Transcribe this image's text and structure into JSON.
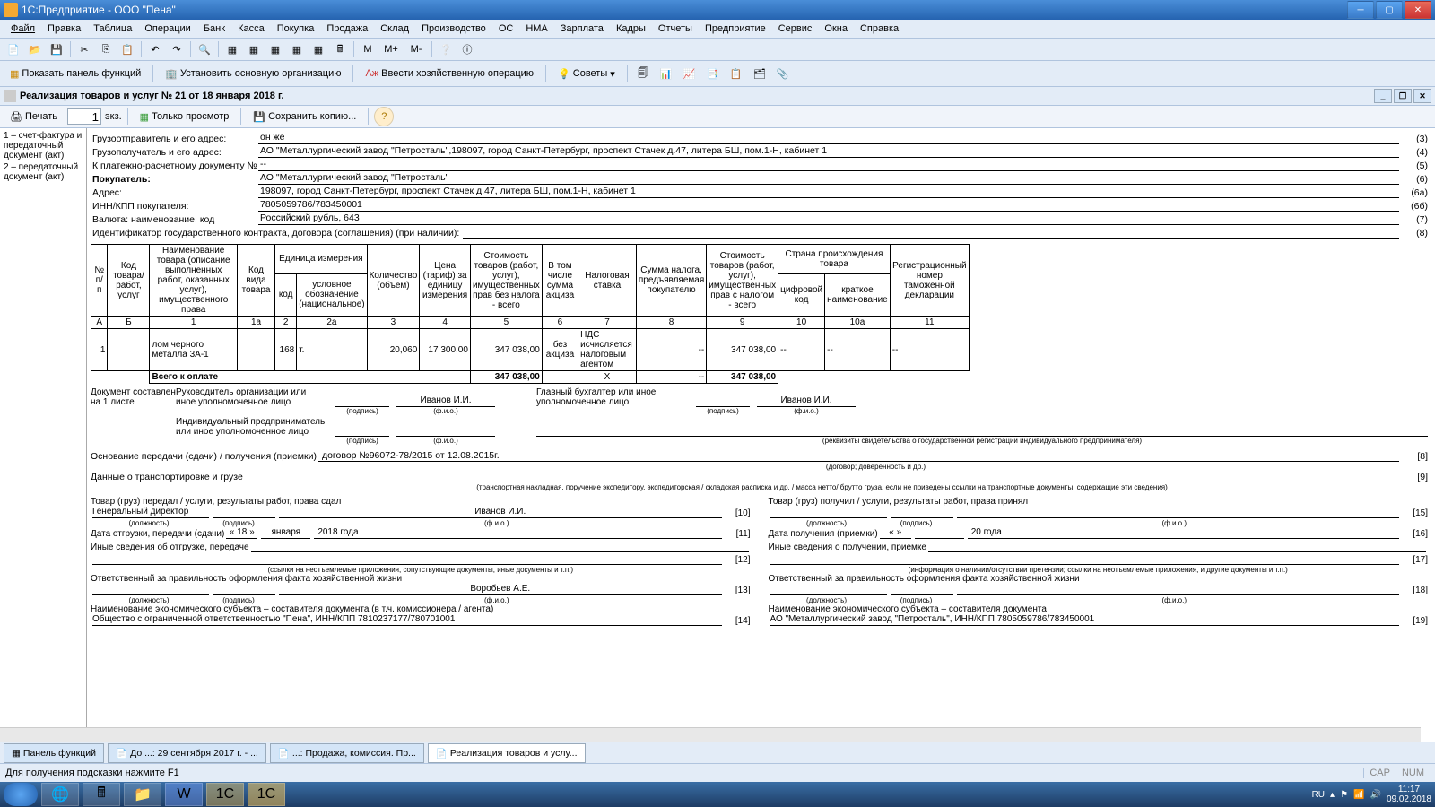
{
  "window": {
    "title": "1С:Предприятие - ООО \"Пена\""
  },
  "menu": [
    "Файл",
    "Правка",
    "Таблица",
    "Операции",
    "Банк",
    "Касса",
    "Покупка",
    "Продажа",
    "Склад",
    "Производство",
    "ОС",
    "НМА",
    "Зарплата",
    "Кадры",
    "Отчеты",
    "Предприятие",
    "Сервис",
    "Окна",
    "Справка"
  ],
  "tb1_text": {
    "m": "M",
    "mplus": "M+",
    "mminus": "M-"
  },
  "tb2": {
    "panel": "Показать панель функций",
    "org": "Установить основную организацию",
    "oper": "Ввести хозяйственную операцию",
    "tips": "Советы"
  },
  "dochdr": "Реализация товаров и услуг № 21 от 18 января 2018 г.",
  "tb3": {
    "print": "Печать",
    "copies": "1",
    "ekz": "экз.",
    "view": "Только просмотр",
    "save": "Сохранить копию..."
  },
  "side": {
    "item1": "1 – счет-фактура и передаточный документ (акт)",
    "item2": "2 – передаточный документ (акт)"
  },
  "hdr": {
    "shipper_lbl": "Грузоотправитель и его адрес:",
    "shipper_val": "он же",
    "shipper_code": "(3)",
    "consignee_lbl": "Грузополучатель и его адрес:",
    "consignee_val": "АО \"Металлургический завод \"Петросталь\",198097, город Санкт-Петербург, проспект Стачек д.47, литера БШ, пом.1-Н, кабинет 1",
    "consignee_code": "(4)",
    "payment_lbl": "К платежно-расчетному документу №",
    "payment_val": "--",
    "payment_code": "(5)",
    "buyer_lbl": "Покупатель:",
    "buyer_val": "АО \"Металлургический завод \"Петросталь\"",
    "buyer_code": "(6)",
    "addr_lbl": "Адрес:",
    "addr_val": "198097, город Санкт-Петербург, проспект Стачек д.47, литера БШ, пом.1-Н, кабинет 1",
    "addr_code": "(6а)",
    "inn_lbl": "ИНН/КПП покупателя:",
    "inn_val": "7805059786/783450001",
    "inn_code": "(6б)",
    "cur_lbl": "Валюта: наименование, код",
    "cur_val": "Российский рубль, 643",
    "cur_code": "(7)",
    "gid_lbl": "Идентификатор государственного контракта, договора (соглашения) (при наличии):",
    "gid_code": "(8)"
  },
  "th": {
    "c1": "№ п/п",
    "c2": "Код товара/ работ, услуг",
    "c3": "Наименование товара (описание выполненных работ, оказанных услуг), имущественного права",
    "c4": "Код вида товара",
    "c5": "Единица измерения",
    "c5a": "код",
    "c5b": "условное обозначение (национальное)",
    "c6": "Количество (объем)",
    "c7": "Цена (тариф) за единицу измерения",
    "c8": "Стоимость товаров (работ, услуг), имущественных прав без налога - всего",
    "c9": "В том числе сумма акциза",
    "c10": "Налоговая ставка",
    "c11": "Сумма налога, предъявляемая покупателю",
    "c12": "Стоимость товаров (работ, услуг), имущественных прав с налогом - всего",
    "c13": "Страна происхождения товара",
    "c13a": "цифровой код",
    "c13b": "краткое наименование",
    "c14": "Регистрационный номер таможенной декларации"
  },
  "idx": {
    "a": "А",
    "b": "Б",
    "1": "1",
    "1a": "1а",
    "2": "2",
    "2a": "2а",
    "3": "3",
    "4": "4",
    "5": "5",
    "6": "6",
    "7": "7",
    "8": "8",
    "9": "9",
    "10": "10",
    "10a": "10а",
    "11": "11"
  },
  "row": {
    "n": "1",
    "name": "лом черного металла 3А-1",
    "unitcode": "168",
    "unitname": "т.",
    "qty": "20,060",
    "price": "17 300,00",
    "sum_wo": "347 038,00",
    "excise": "без акциза",
    "vat": "НДС исчисляется налоговым агентом",
    "tax": "--",
    "sum_w": "347 038,00",
    "ccode": "--",
    "cname": "--",
    "decl": "--"
  },
  "total": {
    "lbl": "Всего к оплате",
    "sum_wo": "347 038,00",
    "x": "Х",
    "tax": "--",
    "sum_w": "347 038,00"
  },
  "sig": {
    "doc_made": "Документ составлен на 1 листе",
    "head": "Руководитель организации или иное уполномоченное лицо",
    "chief": "Главный бухгалтер или иное уполномоченное лицо",
    "ip": "Индивидуальный предприниматель или иное уполномоченное лицо",
    "name": "Иванов И.И.",
    "podpis": "(подпись)",
    "fio": "(ф.и.о.)",
    "rekv": "(реквизиты свидетельства о государственной регистрации индивидуального предпринимателя)"
  },
  "base": {
    "lbl": "Основание передачи (сдачи) / получения (приемки)",
    "val": "договор №96072-78/2015 от 12.08.2015г.",
    "code": "[8]",
    "hint": "(договор; доверенность и др.)"
  },
  "trans": {
    "lbl": "Данные о транспортировке и грузе",
    "code": "[9]",
    "hint": "(транспортная накладная, поручение экспедитору, экспедиторская / складская расписка и др. / масса нетто/ брутто груза, если не приведены ссылки на транспортные документы, содержащие эти сведения)"
  },
  "left": {
    "l1": "Товар (груз) передал / услуги, результаты работ, права сдал",
    "pos": "Генеральный директор",
    "name": "Иванов И.И.",
    "c10": "[10]",
    "pos_h": "(должность)",
    "sig_h": "(подпись)",
    "fio_h": "(ф.и.о.)",
    "date": "Дата отгрузки, передачи (сдачи)",
    "d_d": "« 18 »",
    "d_m": "января",
    "d_y": "2018  года",
    "c11": "[11]",
    "other": "Иные сведения об отгрузке, передаче",
    "c12": "[12]",
    "other_h": "(ссылки на неотъемлемые приложения, сопутствующие документы, иные документы и т.п.)",
    "resp": "Ответственный за правильность оформления факта хозяйственной жизни",
    "rname": "Воробьев А.Е.",
    "c13": "[13]",
    "subj": "Наименование экономического субъекта – составителя документа (в т.ч. комиссионера / агента)",
    "subj_val": "Общество с ограниченной ответственностью \"Пена\", ИНН/КПП 7810237177/780701001",
    "c14": "[14]"
  },
  "right": {
    "l1": "Товар (груз) получил / услуги, результаты работ, права принял",
    "c15": "[15]",
    "date": "Дата получения (приемки)",
    "d_d": "«      »",
    "d_y": "20     года",
    "c16": "[16]",
    "other": "Иные сведения о получении, приемке",
    "c17": "[17]",
    "other_h": "(информация о наличии/отсутствии претензии; ссылки на неотъемлемые приложения, и другие документы и т.п.)",
    "resp": "Ответственный за правильность оформления факта хозяйственной жизни",
    "c18": "[18]",
    "subj": "Наименование экономического субъекта – составителя документа",
    "subj_val": "АО \"Металлургический завод \"Петросталь\", ИНН/КПП 7805059786/783450001",
    "c19": "[19]"
  },
  "tasks": {
    "t1": "Панель функций",
    "t2": "До ...: 29 сентября 2017 г. - ...",
    "t3": "...: Продажа, комиссия. Пр...",
    "t4": "Реализация товаров и услу..."
  },
  "status": {
    "hint": "Для получения подсказки нажмите F1",
    "cap": "CAP",
    "num": "NUM"
  },
  "tray": {
    "lang": "RU",
    "time": "11:17",
    "date": "09.02.2018"
  }
}
